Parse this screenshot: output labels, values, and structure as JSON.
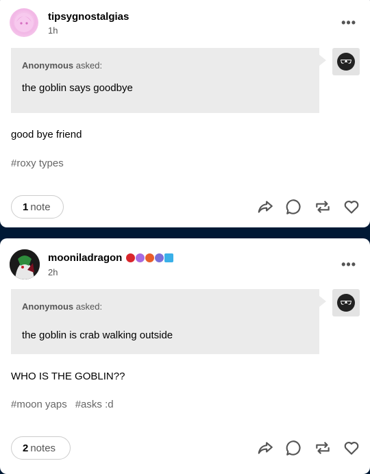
{
  "posts": [
    {
      "username": "tipsygnostalgias",
      "time": "1h",
      "asker": "Anonymous",
      "asked_label": "asked:",
      "question": "the goblin says goodbye",
      "answer": "good bye friend",
      "tags": [
        "#roxy types"
      ],
      "notes_count": "1",
      "notes_label": "note"
    },
    {
      "username": "mooniladragon",
      "time": "2h",
      "asker": "Anonymous",
      "asked_label": "asked:",
      "question": "the goblin is crab walking outside",
      "answer": "WHO IS THE GOBLIN??",
      "tags": [
        "#moon yaps",
        "#asks :d"
      ],
      "notes_count": "2",
      "notes_label": "notes"
    }
  ],
  "icons": {
    "more": "more-horizontal-icon",
    "share": "share-icon",
    "reply": "reply-icon",
    "reblog": "reblog-icon",
    "like": "heart-icon"
  },
  "colors": {
    "background": "#001935",
    "ask_box": "#ebebeb"
  }
}
